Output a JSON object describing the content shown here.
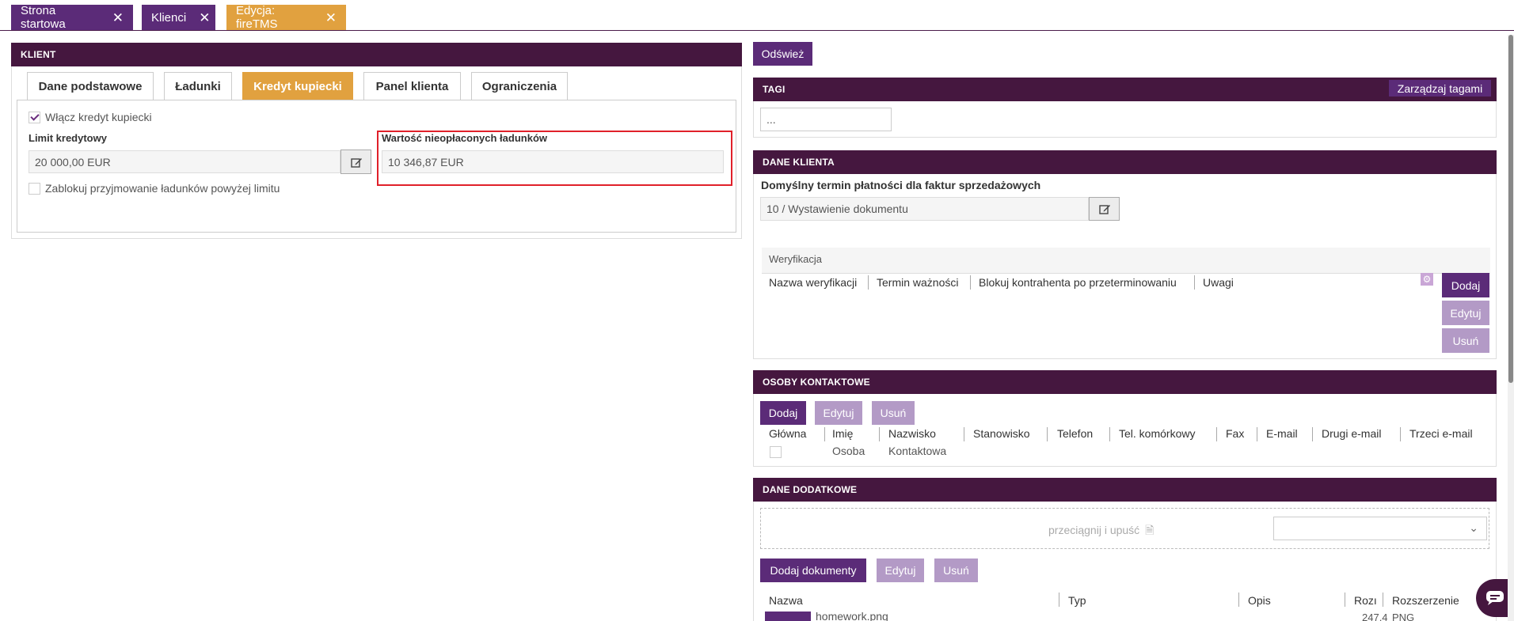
{
  "top_tabs": [
    {
      "label": "Strona startowa"
    },
    {
      "label": "Klienci"
    },
    {
      "label": "Edycja: fireTMS"
    }
  ],
  "left": {
    "panel_title": "KLIENT",
    "tabs": [
      "Dane podstawowe",
      "Ładunki",
      "Kredyt kupiecki",
      "Panel klienta",
      "Ograniczenia"
    ],
    "enable_credit_label": "Włącz kredyt kupiecki",
    "credit_limit_label": "Limit kredytowy",
    "credit_limit_value": "20 000,00 EUR",
    "unpaid_label": "Wartość nieopłaconych ładunków",
    "unpaid_value": "10 346,87 EUR",
    "block_label": "Zablokuj przyjmowanie ładunków powyżej limitu"
  },
  "right": {
    "refresh_label": "Odśwież",
    "tags": {
      "title": "TAGI",
      "manage_label": "Zarządzaj tagami",
      "input_value": "..."
    },
    "client_data": {
      "title": "DANE KLIENTA",
      "payment_label": "Domyślny termin płatności dla faktur sprzedażowych",
      "payment_value": "10 / Wystawienie dokumentu",
      "verification_title": "Weryfikacja",
      "columns": [
        "Nazwa weryfikacji",
        "Termin ważności",
        "Blokuj kontrahenta po przeterminowaniu",
        "Uwagi"
      ],
      "add_label": "Dodaj",
      "edit_label": "Edytuj",
      "delete_label": "Usuń"
    },
    "contacts": {
      "title": "OSOBY KONTAKTOWE",
      "add_label": "Dodaj",
      "edit_label": "Edytuj",
      "delete_label": "Usuń",
      "columns": [
        "Główna",
        "Imię",
        "Nazwisko",
        "Stanowisko",
        "Telefon",
        "Tel. komórkowy",
        "Fax",
        "E-mail",
        "Drugi e-mail",
        "Trzeci e-mail"
      ],
      "rows": [
        {
          "first_name": "Osoba",
          "last_name": "Kontaktowa"
        }
      ]
    },
    "extra": {
      "title": "DANE DODATKOWE",
      "drop_label": "przeciągnij i upuść",
      "add_docs_label": "Dodaj dokumenty",
      "edit_label": "Edytuj",
      "delete_label": "Usuń",
      "columns": [
        "Nazwa",
        "Typ",
        "Opis",
        "Rozı",
        "Rozszerzenie"
      ],
      "rows": [
        {
          "name": "homework.png",
          "size": "247,4",
          "ext": "PNG"
        }
      ]
    }
  },
  "colors": {
    "purple": "#5b2b78",
    "dark_header": "#45173f",
    "orange": "#e1a13f",
    "highlight": "#e0202a"
  }
}
